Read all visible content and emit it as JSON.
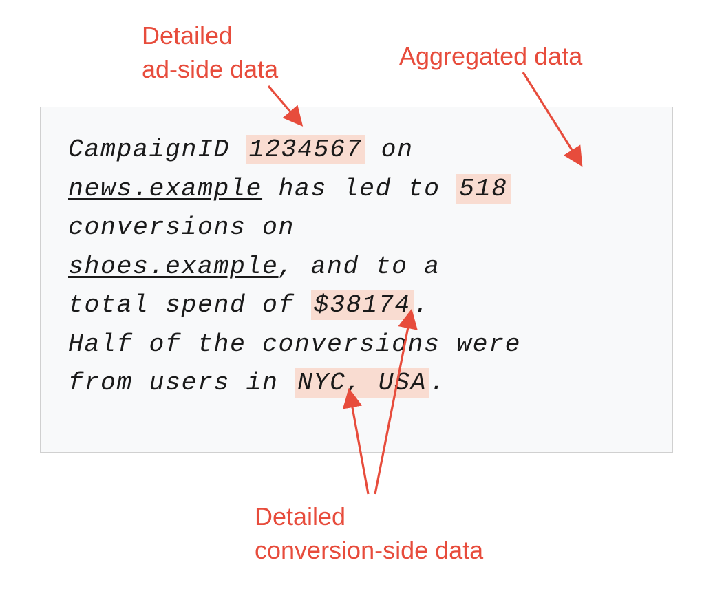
{
  "labels": {
    "topLeft": "Detailed\nad-side data",
    "topRight": "Aggregated data",
    "bottom": "Detailed\nconversion-side data"
  },
  "content": {
    "pre1": "CampaignID ",
    "campaignId": "1234567",
    "post1": " on ",
    "site1": "news.example",
    "mid1": " has led to ",
    "conversions": "518",
    "post2": " conversions on ",
    "site2": "shoes.example",
    "mid2": ", and to a",
    "mid3": "total spend of ",
    "spend": "$38174",
    "period": ".",
    "line4a": "Half of the conversions were",
    "line5a": "from users in ",
    "location": "NYC, USA",
    "end": "."
  },
  "colors": {
    "accent": "#e74c3c",
    "highlight": "#f9dcd1",
    "boxBg": "#f8f9fa",
    "boxBorder": "#d0d0d0"
  }
}
